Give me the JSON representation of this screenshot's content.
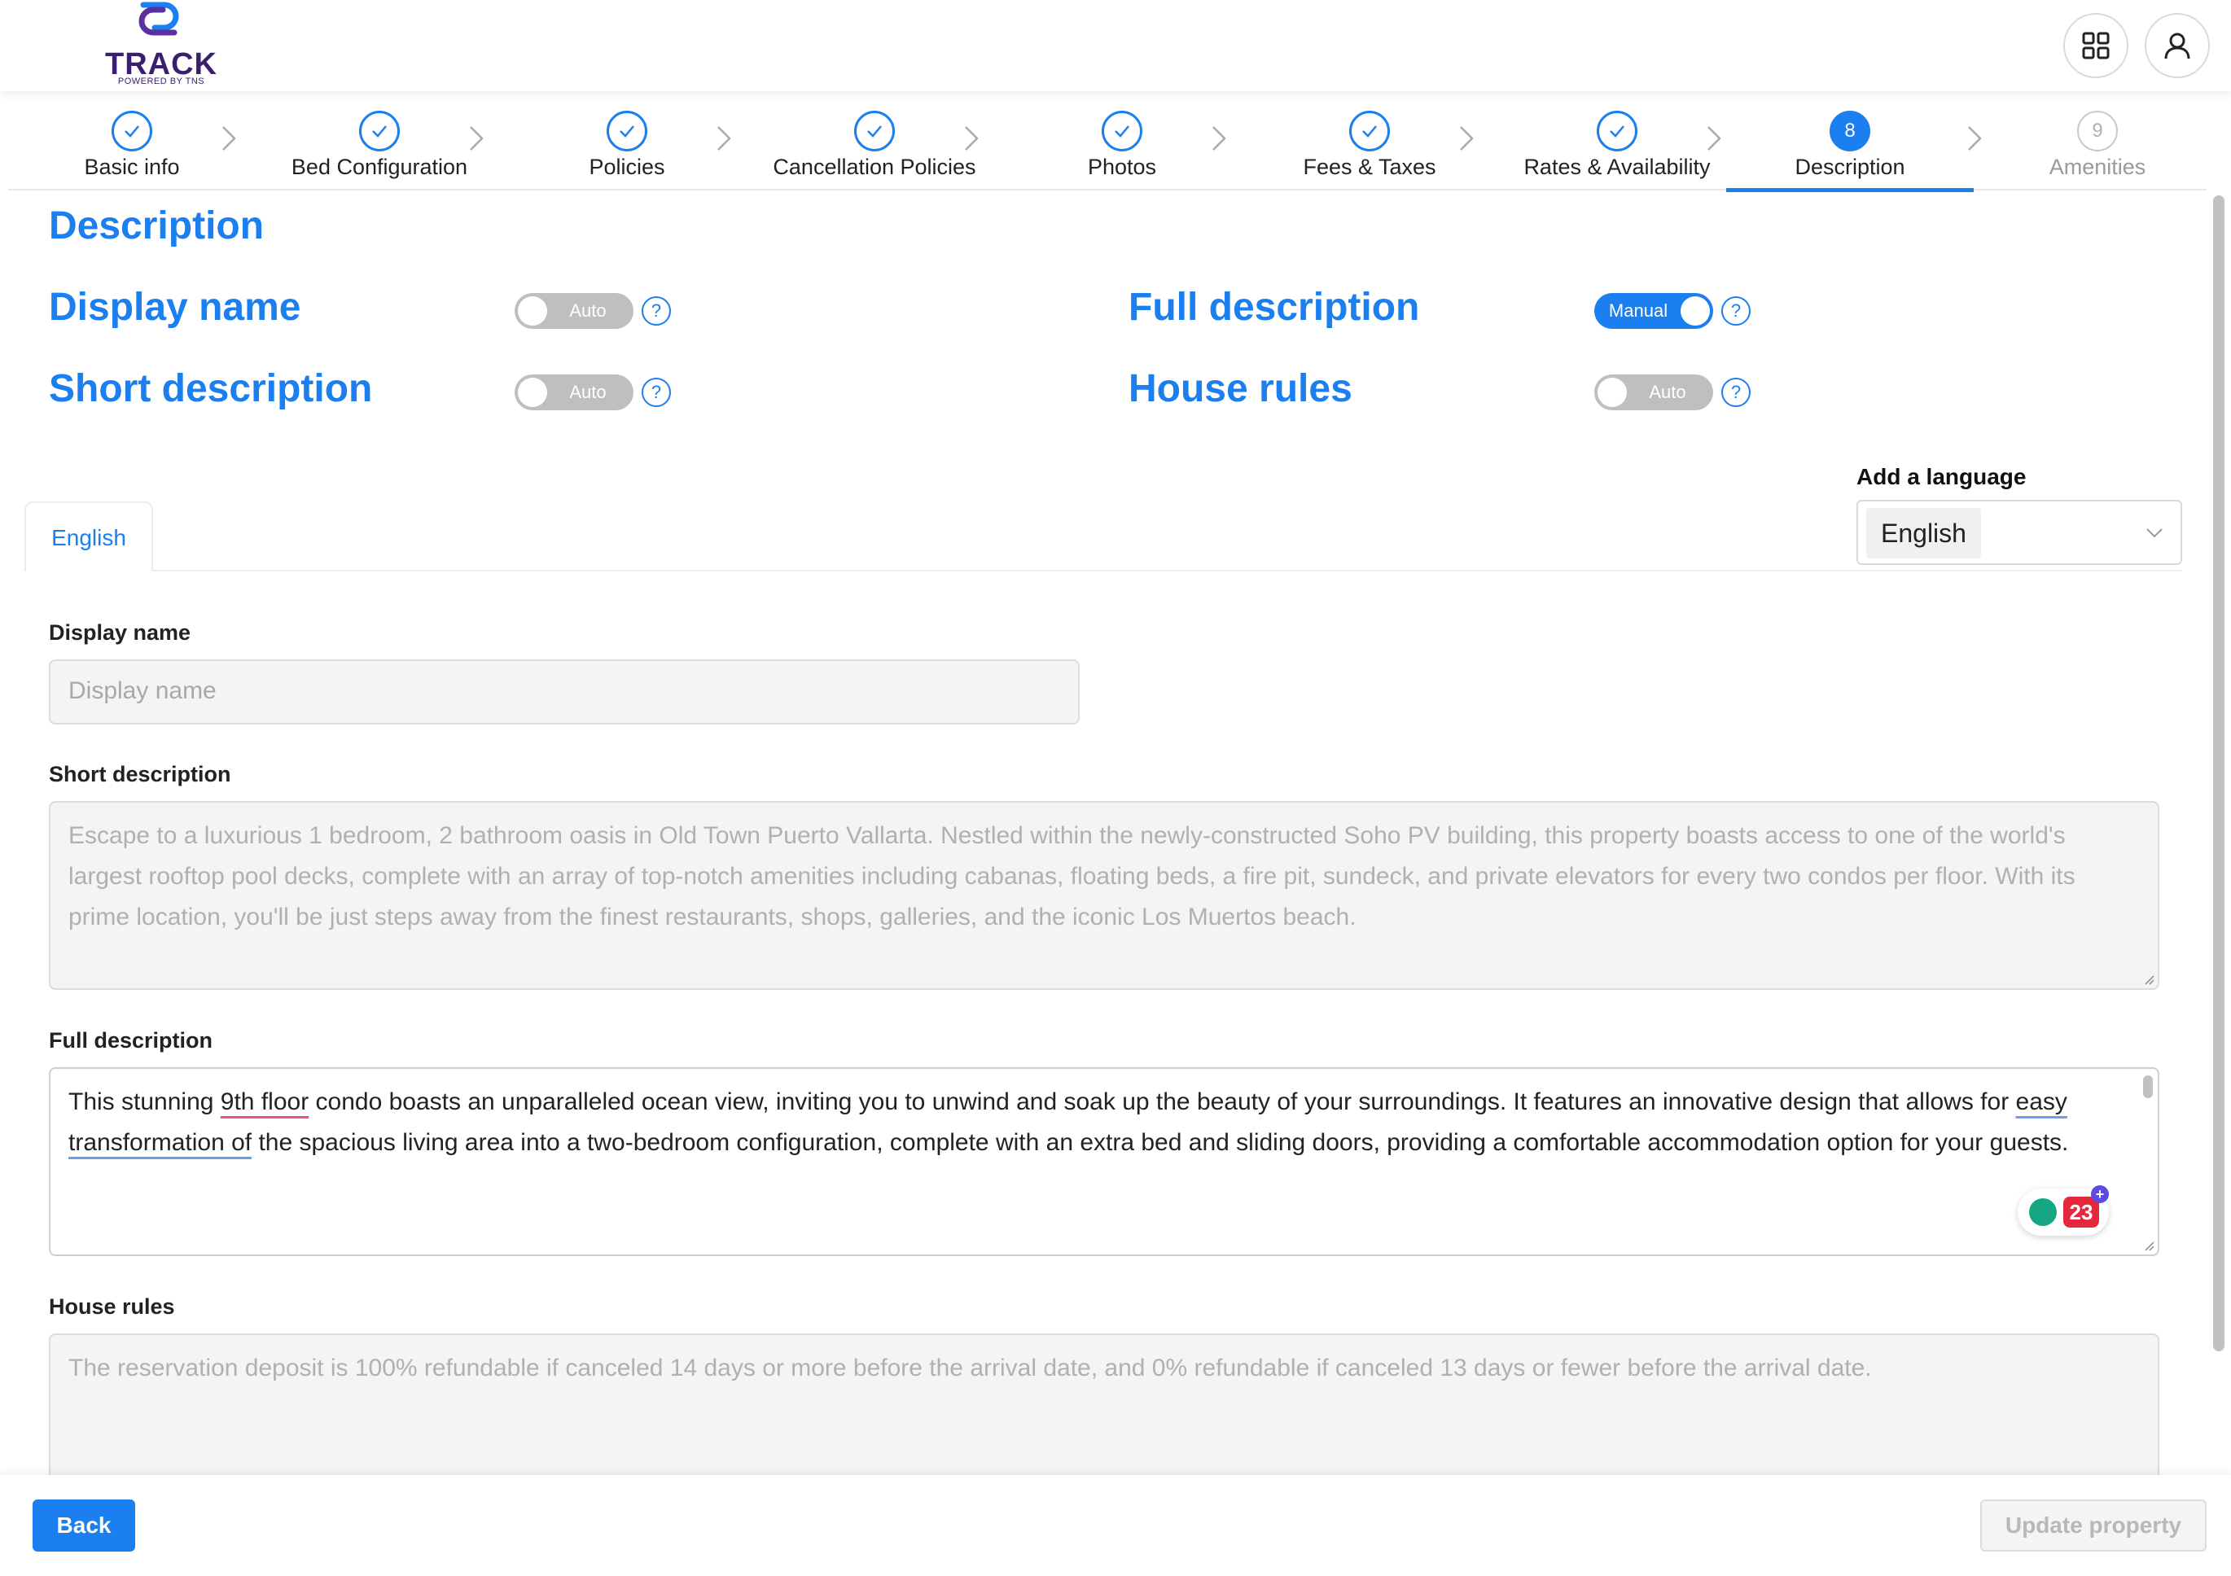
{
  "header": {
    "logo_text": "TRACK",
    "logo_sub": "POWERED BY TNS",
    "apps_icon": "grid-icon",
    "user_icon": "user-icon"
  },
  "steps": [
    {
      "label": "Basic info",
      "state": "done"
    },
    {
      "label": "Bed Configuration",
      "state": "done"
    },
    {
      "label": "Policies",
      "state": "done"
    },
    {
      "label": "Cancellation Policies",
      "state": "done"
    },
    {
      "label": "Photos",
      "state": "done"
    },
    {
      "label": "Fees & Taxes",
      "state": "done"
    },
    {
      "label": "Rates & Availability",
      "state": "done"
    },
    {
      "label": "Description",
      "state": "active",
      "number": "8"
    },
    {
      "label": "Amenities",
      "state": "pending",
      "number": "9"
    }
  ],
  "page": {
    "title": "Description"
  },
  "settings": {
    "display_name": {
      "title": "Display name",
      "toggle": "Auto"
    },
    "short_description": {
      "title": "Short description",
      "toggle": "Auto"
    },
    "full_description": {
      "title": "Full description",
      "toggle": "Manual"
    },
    "house_rules": {
      "title": "House rules",
      "toggle": "Auto"
    },
    "help": "?"
  },
  "language": {
    "label": "Add a language",
    "selected": "English",
    "tab": "English"
  },
  "form": {
    "display_name": {
      "label": "Display name",
      "placeholder": "Display name"
    },
    "short_description": {
      "label": "Short description",
      "value": "Escape to a luxurious 1 bedroom, 2 bathroom oasis in Old Town Puerto Vallarta. Nestled within the newly-constructed Soho PV building, this property boasts access to one of the world's largest rooftop pool decks, complete with an array of top-notch amenities including cabanas, floating beds, a fire pit, sundeck, and private elevators for every two condos per floor. With its prime location, you'll be just steps away from the finest restaurants, shops, galleries, and the iconic Los Muertos beach."
    },
    "full_description": {
      "label": "Full description",
      "part1": "This stunning ",
      "mark1": "9th floor",
      "part2": " condo boasts an unparalleled ocean view, inviting you to unwind and soak up the beauty of your surroundings. It features an innovative design that allows for ",
      "mark2": "easy transformation of",
      "part3": " the spacious living area into a two-bedroom configuration, complete with an extra bed and sliding doors, providing a comfortable accommodation option for your guests.",
      "grammar_count": "23"
    },
    "house_rules": {
      "label": "House rules",
      "value": "The reservation deposit is 100% refundable if canceled 14 days or more before the arrival date, and 0% refundable if canceled 13 days or fewer before the arrival date."
    }
  },
  "footer": {
    "back": "Back",
    "update": "Update property"
  }
}
